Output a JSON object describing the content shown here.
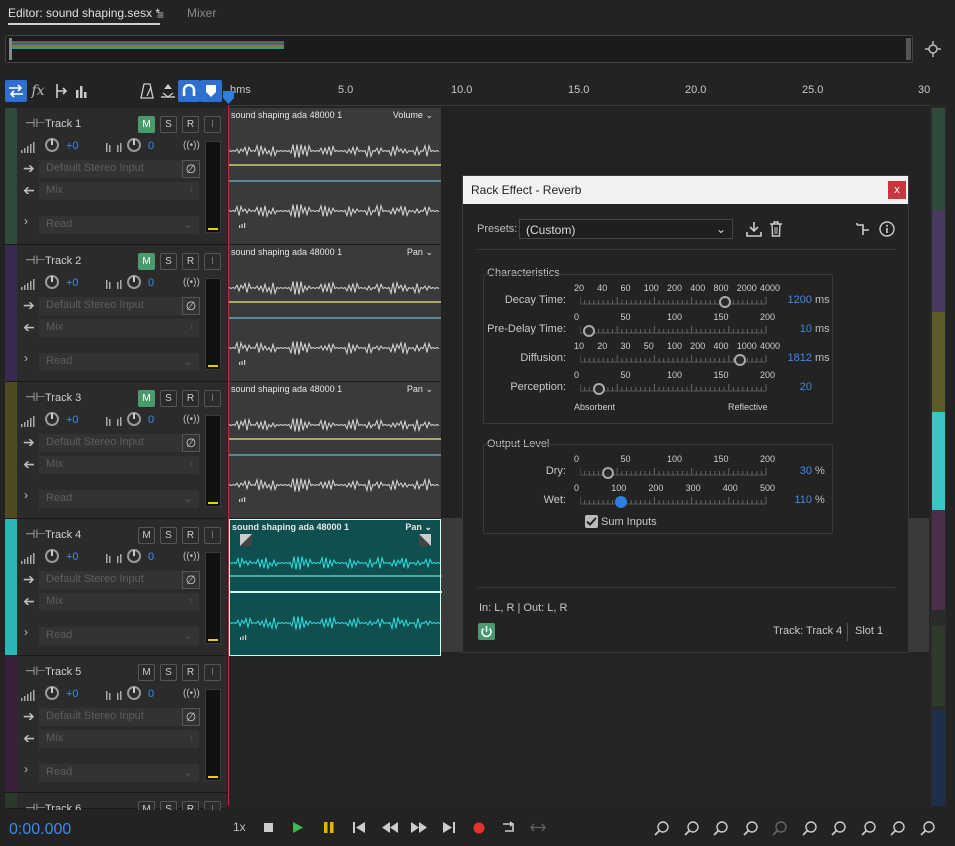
{
  "tabs": {
    "editor": "Editor: sound shaping.sesx *",
    "menu": "≡",
    "mixer": "Mixer"
  },
  "ruler": {
    "labels": [
      "hms",
      "5.0",
      "10.0",
      "15.0",
      "20.0",
      "25.0",
      "30"
    ]
  },
  "tracks": [
    {
      "name": "Track 1",
      "vol": "+0",
      "pan": "0",
      "input": "Default Stereo Input",
      "send": "Mix",
      "automation": "Read",
      "color": "#2f4a3a",
      "mute_on": true
    },
    {
      "name": "Track 2",
      "vol": "+0",
      "pan": "0",
      "input": "Default Stereo Input",
      "send": "Mix",
      "automation": "Read",
      "color": "#3b2a4f",
      "mute_on": true
    },
    {
      "name": "Track 3",
      "vol": "+0",
      "pan": "0",
      "input": "Default Stereo Input",
      "send": "Mix",
      "automation": "Read",
      "color": "#4f4a22",
      "mute_on": true
    },
    {
      "name": "Track 4",
      "vol": "+0",
      "pan": "0",
      "input": "Default Stereo Input",
      "send": "Mix",
      "automation": "Read",
      "color": "#2bb5b5",
      "mute_on": false
    },
    {
      "name": "Track 5",
      "vol": "+0",
      "pan": "0",
      "input": "Default Stereo Input",
      "send": "Mix",
      "automation": "Read",
      "color": "#3a1f3a",
      "mute_on": false
    },
    {
      "name": "Track 6"
    }
  ],
  "track_buttons": {
    "m": "M",
    "s": "S",
    "r": "R",
    "i": "I"
  },
  "clips": [
    {
      "title": "sound shaping ada 48000 1",
      "mode": "Volume"
    },
    {
      "title": "sound shaping ada 48000 1",
      "mode": "Pan"
    },
    {
      "title": "sound shaping ada 48000 1",
      "mode": "Pan"
    },
    {
      "title": "sound shaping ada 48000 1",
      "mode": "Pan"
    }
  ],
  "rack": {
    "title": "Rack Effect - Reverb",
    "close": "x",
    "presets_label": "Presets:",
    "preset_value": "(Custom)",
    "characteristics": "Characteristics",
    "params": [
      {
        "label": "Decay Time:",
        "scale": [
          "20",
          "40",
          "60",
          "100",
          "200",
          "400",
          "800",
          "2000",
          "4000"
        ],
        "value": "1200",
        "unit": "ms",
        "pos": 0.78
      },
      {
        "label": "Pre-Delay Time:",
        "scale": [
          "0",
          "50",
          "100",
          "150",
          "200"
        ],
        "value": "10",
        "unit": "ms",
        "pos": 0.05
      },
      {
        "label": "Diffusion:",
        "scale": [
          "10",
          "20",
          "30",
          "50",
          "100",
          "200",
          "400",
          "1000",
          "4000"
        ],
        "value": "1812",
        "unit": "ms",
        "pos": 0.86
      },
      {
        "label": "Perception:",
        "scale": [
          "0",
          "50",
          "100",
          "150",
          "200"
        ],
        "value": "20",
        "unit": "",
        "pos": 0.1
      }
    ],
    "perception_left": "Absorbent",
    "perception_right": "Reflective",
    "output_level": "Output Level",
    "dry": {
      "label": "Dry:",
      "scale": [
        "0",
        "50",
        "100",
        "150",
        "200"
      ],
      "value": "30",
      "unit": "%",
      "pos": 0.15
    },
    "wet": {
      "label": "Wet:",
      "scale": [
        "0",
        "100",
        "200",
        "300",
        "400",
        "500"
      ],
      "value": "110",
      "unit": "%",
      "pos": 0.22
    },
    "sum_inputs": "Sum Inputs",
    "io": "In: L, R | Out: L, R",
    "track_label": "Track: Track 4",
    "slot_label": "Slot 1"
  },
  "transport": {
    "time": "0:00.000",
    "speed": "1x"
  },
  "colors": {
    "accent": "#3d8be8",
    "teal_clip": "#0f4f4f",
    "wave_teal": "#2ee0e0",
    "close_red": "#c8373d",
    "power_green": "#4a9a6d"
  }
}
